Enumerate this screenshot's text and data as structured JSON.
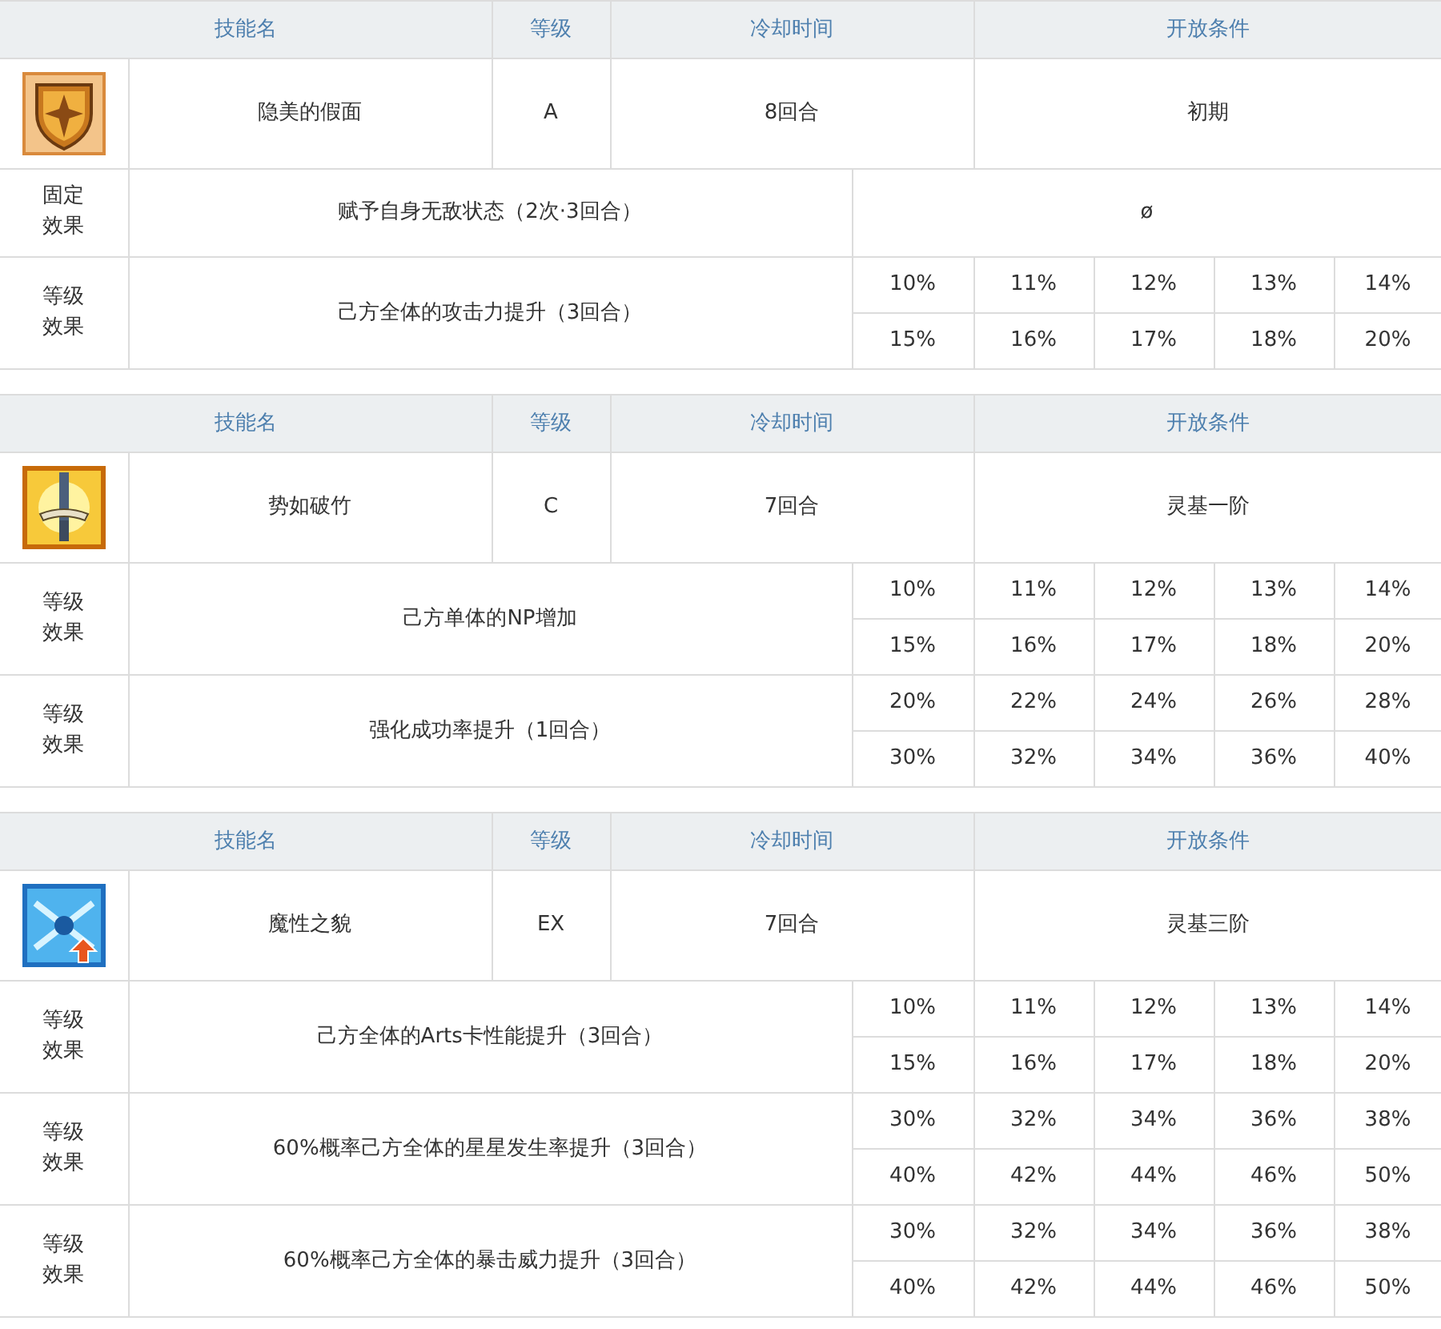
{
  "skills": [
    {
      "header": {
        "name": "技能名",
        "grade": "等级",
        "cooldown": "冷却时间",
        "condition": "开放条件"
      },
      "name": "隐美的假面",
      "grade": "A",
      "cooldown": "8回合",
      "condition": "初期",
      "effects": [
        {
          "kind": "fixed",
          "label": "固定效果",
          "text": "赋予自身无敌状态（2次·3回合）",
          "value": "ø"
        },
        {
          "kind": "levels",
          "label": "等级效果",
          "text": "己方全体的攻击力提升（3回合）",
          "values": [
            [
              "10%",
              "11%",
              "12%",
              "13%",
              "14%"
            ],
            [
              "15%",
              "16%",
              "17%",
              "18%",
              "20%"
            ]
          ]
        }
      ]
    },
    {
      "header": {
        "name": "技能名",
        "grade": "等级",
        "cooldown": "冷却时间",
        "condition": "开放条件"
      },
      "name": "势如破竹",
      "grade": "C",
      "cooldown": "7回合",
      "condition": "灵基一阶",
      "effects": [
        {
          "kind": "levels",
          "label": "等级效果",
          "text": "己方单体的NP增加",
          "values": [
            [
              "10%",
              "11%",
              "12%",
              "13%",
              "14%"
            ],
            [
              "15%",
              "16%",
              "17%",
              "18%",
              "20%"
            ]
          ]
        },
        {
          "kind": "levels",
          "label": "等级效果",
          "text": "强化成功率提升（1回合）",
          "values": [
            [
              "20%",
              "22%",
              "24%",
              "26%",
              "28%"
            ],
            [
              "30%",
              "32%",
              "34%",
              "36%",
              "40%"
            ]
          ]
        }
      ]
    },
    {
      "header": {
        "name": "技能名",
        "grade": "等级",
        "cooldown": "冷却时间",
        "condition": "开放条件"
      },
      "name": "魔性之貌",
      "grade": "EX",
      "cooldown": "7回合",
      "condition": "灵基三阶",
      "effects": [
        {
          "kind": "levels",
          "label": "等级效果",
          "text": "己方全体的Arts卡性能提升（3回合）",
          "values": [
            [
              "10%",
              "11%",
              "12%",
              "13%",
              "14%"
            ],
            [
              "15%",
              "16%",
              "17%",
              "18%",
              "20%"
            ]
          ]
        },
        {
          "kind": "levels",
          "label": "等级效果",
          "text": "60%概率己方全体的星星发生率提升（3回合）",
          "values": [
            [
              "30%",
              "32%",
              "34%",
              "36%",
              "38%"
            ],
            [
              "40%",
              "42%",
              "44%",
              "46%",
              "50%"
            ]
          ]
        },
        {
          "kind": "levels",
          "label": "等级效果",
          "text": "60%概率己方全体的暴击威力提升（3回合）",
          "values": [
            [
              "30%",
              "32%",
              "34%",
              "36%",
              "38%"
            ],
            [
              "40%",
              "42%",
              "44%",
              "46%",
              "50%"
            ]
          ]
        }
      ]
    }
  ]
}
